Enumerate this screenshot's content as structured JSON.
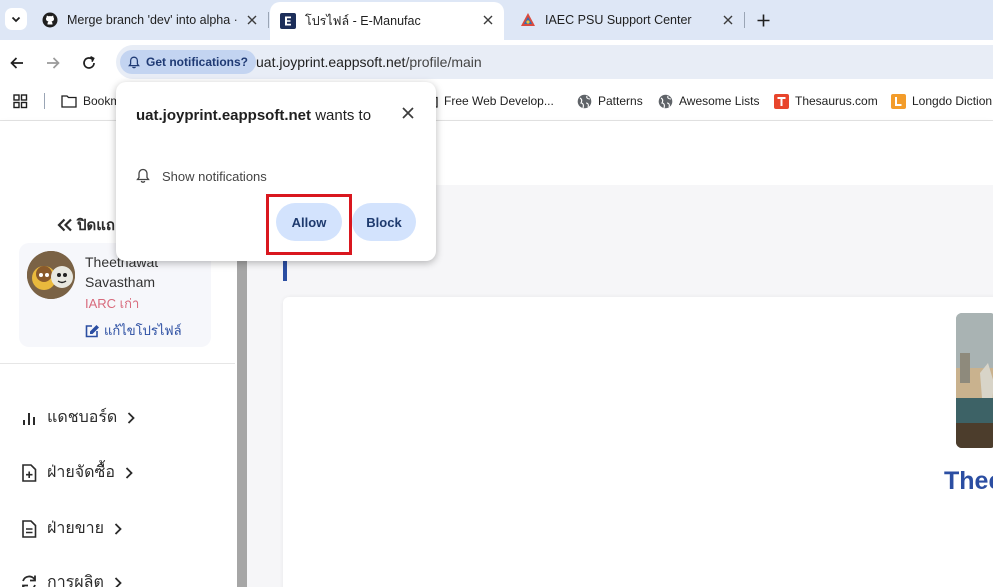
{
  "browser": {
    "tabs": [
      {
        "title": "Merge branch 'dev' into alpha ·",
        "favicon": "github-icon",
        "active": false
      },
      {
        "title": "โปรไฟล์ - E-Manufac",
        "favicon": "e-logo-icon",
        "active": true
      },
      {
        "title": "IAEC PSU Support Center",
        "favicon": "iaec-logo-icon",
        "active": false
      }
    ],
    "notification_chip": "Get notifications?",
    "url_domain": "uat.joyprint.eappsoft.net",
    "url_path": "/profile/main",
    "bookmarks": [
      {
        "label": "Bookm",
        "icon": "folder-icon"
      },
      {
        "label": "Free Web Develop...",
        "icon": "folder-icon"
      },
      {
        "label": "Patterns",
        "icon": "globe-icon"
      },
      {
        "label": "Awesome Lists",
        "icon": "globe-icon"
      },
      {
        "label": "Thesaurus.com",
        "icon": "thesaurus-icon"
      },
      {
        "label": "Longdo Diction",
        "icon": "longdo-icon"
      }
    ]
  },
  "permission_popup": {
    "site": "uat.joyprint.eappsoft.net",
    "title_suffix": "wants to",
    "permission": "Show notifications",
    "allow_label": "Allow",
    "block_label": "Block"
  },
  "sidebar": {
    "collapse_label": "ปิดแถ",
    "profile": {
      "name": "Theethawat Savastham",
      "role": "IARC เก่า",
      "edit_label": "แก้ไขโปรไฟล์"
    },
    "menu": [
      {
        "label": "แดชบอร์ด",
        "icon": "bar-chart-icon"
      },
      {
        "label": "ฝ่ายจัดซื้อ",
        "icon": "file-plus-icon"
      },
      {
        "label": "ฝ่ายขาย",
        "icon": "document-icon"
      },
      {
        "label": "การผลิต",
        "icon": "refresh-icon"
      }
    ]
  },
  "main": {
    "profile_name_partial": "Thee"
  },
  "colors": {
    "accent": "#2b4ea2",
    "highlight": "#d9171f",
    "button_bg": "#d3e3fd"
  }
}
